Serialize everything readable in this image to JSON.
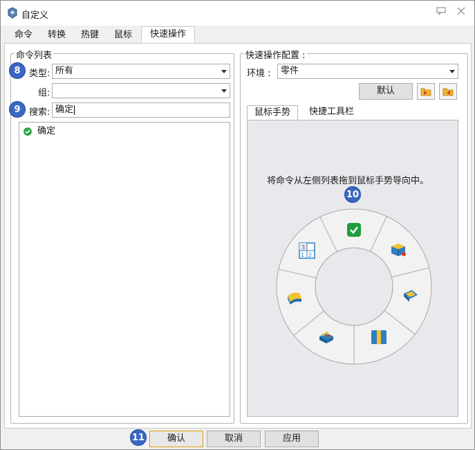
{
  "window": {
    "title": "自定义",
    "controls": [
      "comment-icon",
      "close-icon"
    ]
  },
  "top_tabs": [
    {
      "label": "命令"
    },
    {
      "label": "转换"
    },
    {
      "label": "热键"
    },
    {
      "label": "鼠标"
    },
    {
      "label": "快速操作",
      "active": true
    }
  ],
  "command_list": {
    "legend": "命令列表",
    "type_label": "类型:",
    "type_value": "所有",
    "group_label": "组:",
    "group_value": "",
    "search_label": "搜索:",
    "search_value": "确定",
    "items": [
      {
        "label": "确定",
        "icon": "check-circle-icon"
      }
    ]
  },
  "quick_config": {
    "legend": "快速操作配置 :",
    "env_label": "环境 :",
    "env_value": "零件",
    "default_button": "默认",
    "import_icon": "folder-import-icon",
    "export_icon": "folder-export-icon",
    "subtabs": [
      {
        "label": "鼠标手势",
        "active": true
      },
      {
        "label": "快捷工具栏"
      }
    ],
    "hint": "将命令从左侧列表拖到鼠标手势导向中。",
    "wheel_slots": [
      {
        "slot": "top",
        "icon": "check-circle-icon"
      },
      {
        "slot": "top-right",
        "icon": "box-face-icon"
      },
      {
        "slot": "right",
        "icon": "tray-icon"
      },
      {
        "slot": "bottom-right",
        "icon": "bars-icon"
      },
      {
        "slot": "bottom-left",
        "icon": "blocks-icon"
      },
      {
        "slot": "left",
        "icon": "curved-box-icon"
      },
      {
        "slot": "top-left",
        "icon": "numbers-icon"
      }
    ]
  },
  "badges": {
    "b8": "8",
    "b9": "9",
    "b10": "10",
    "b11": "11"
  },
  "footer": {
    "ok": "确认",
    "cancel": "取消",
    "apply": "应用"
  },
  "colors": {
    "accent_badge": "#3a67c4",
    "check_green": "#28a745",
    "primary_border": "#e0a000"
  }
}
